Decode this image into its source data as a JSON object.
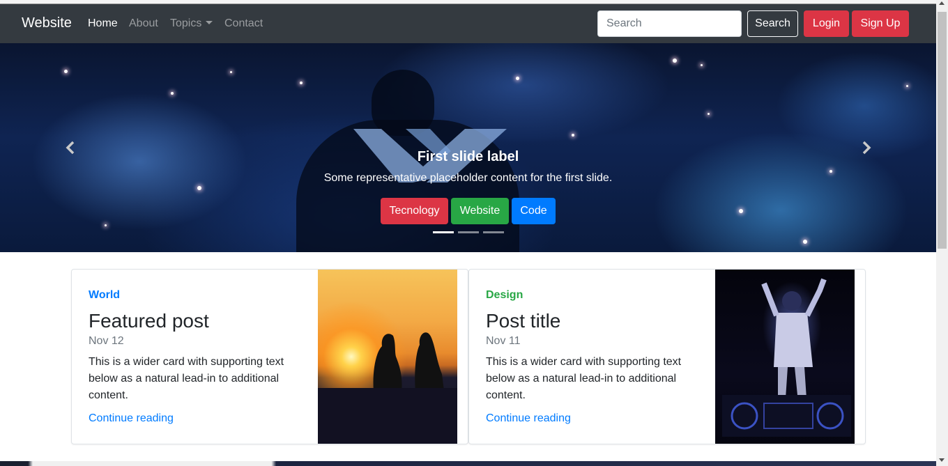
{
  "navbar": {
    "brand": "Website",
    "links": [
      {
        "label": "Home",
        "active": true
      },
      {
        "label": "About",
        "active": false
      },
      {
        "label": "Topics",
        "active": false,
        "dropdown": true
      },
      {
        "label": "Contact",
        "active": false
      }
    ],
    "search_placeholder": "Search",
    "search_button": "Search",
    "login_button": "Login",
    "signup_button": "Sign Up"
  },
  "carousel": {
    "title": "First slide label",
    "text": "Some representative placeholder content for the first slide.",
    "tags": [
      {
        "label": "Tecnology",
        "color": "#dc3545"
      },
      {
        "label": "Website",
        "color": "#28a745"
      },
      {
        "label": "Code",
        "color": "#007bff"
      }
    ],
    "slide_count": 3,
    "active_slide": 1
  },
  "cards": [
    {
      "category": "World",
      "category_color": "#007bff",
      "title": "Featured post",
      "date": "Nov 12",
      "text": "This is a wider card with supporting text below as a natural lead-in to additional content.",
      "link": "Continue reading",
      "image": "sunset-couple"
    },
    {
      "category": "Design",
      "category_color": "#28a745",
      "title": "Post title",
      "date": "Nov 11",
      "text": "This is a wider card with supporting text below as a natural lead-in to additional content.",
      "link": "Continue reading",
      "image": "dj-performer"
    }
  ],
  "colors": {
    "navbar_bg": "#343a40",
    "danger": "#dc3545",
    "success": "#28a745",
    "primary": "#007bff"
  }
}
